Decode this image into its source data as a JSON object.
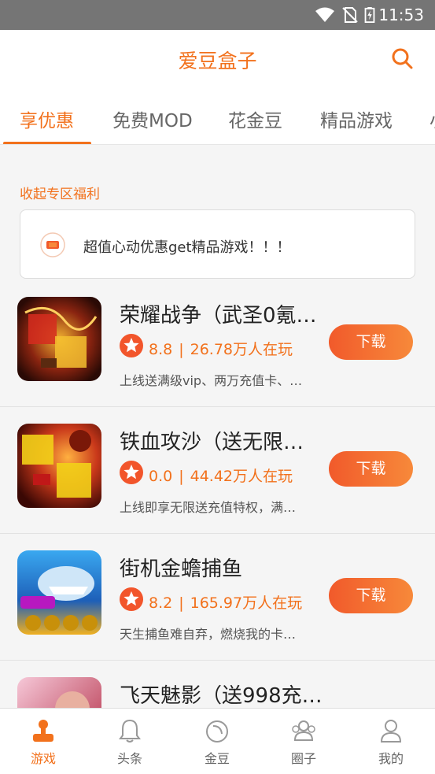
{
  "status_bar": {
    "time": "11:53"
  },
  "header": {
    "title": "爱豆盒子"
  },
  "tabs": [
    {
      "label": "享优惠"
    },
    {
      "label": "免费MOD"
    },
    {
      "label": "花金豆"
    },
    {
      "label": "精品游戏"
    },
    {
      "label": "小"
    }
  ],
  "section": {
    "label": "收起专区福利"
  },
  "promo": {
    "text": "超值心动优惠get精品游戏！！！"
  },
  "games": [
    {
      "name": "荣耀战争（武圣0氪…",
      "rating": "8.8",
      "players": "26.78万人在玩",
      "desc": "上线送满级vip、两万充值卡、…",
      "button": "下载"
    },
    {
      "name": "铁血攻沙（送无限…",
      "rating": "0.0",
      "players": "44.42万人在玩",
      "desc": "上线即享无限送充值特权，满…",
      "button": "下载"
    },
    {
      "name": "街机金蟾捕鱼",
      "rating": "8.2",
      "players": "165.97万人在玩",
      "desc": "天生捕鱼难自弃，燃烧我的卡…",
      "button": "下载"
    },
    {
      "name": "飞天魅影（送998充…",
      "rating": "",
      "players": "",
      "desc": "",
      "button": ""
    }
  ],
  "meta_separator": "|",
  "bottom_nav": [
    {
      "label": "游戏"
    },
    {
      "label": "头条"
    },
    {
      "label": "金豆"
    },
    {
      "label": "圈子"
    },
    {
      "label": "我的"
    }
  ],
  "colors": {
    "accent": "#f2711c",
    "button": "#f15a2b"
  }
}
